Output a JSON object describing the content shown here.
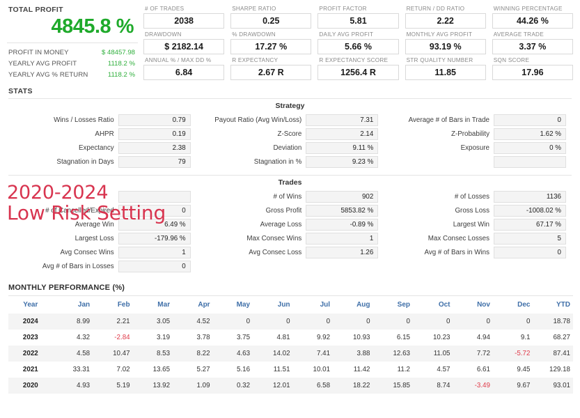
{
  "colors": {
    "green": "#1faa2b",
    "red_overlay": "#d8344f",
    "negative": "#e03b4a",
    "header_blue": "#3f6fa8"
  },
  "summary": {
    "title": "TOTAL PROFIT",
    "big_value": "4845.8 %",
    "rows": [
      {
        "label": "PROFIT IN MONEY",
        "value": "$ 48457.98"
      },
      {
        "label": "YEARLY AVG PROFIT",
        "value": "1118.2 %"
      },
      {
        "label": "YEARLY AVG % RETURN",
        "value": "1118.2 %"
      }
    ]
  },
  "kpis": [
    {
      "label": "# OF TRADES",
      "value": "2038"
    },
    {
      "label": "SHARPE RATIO",
      "value": "0.25"
    },
    {
      "label": "PROFIT FACTOR",
      "value": "5.81"
    },
    {
      "label": "RETURN / DD RATIO",
      "value": "2.22"
    },
    {
      "label": "WINNING PERCENTAGE",
      "value": "44.26 %"
    },
    {
      "label": "DRAWDOWN",
      "value": "$ 2182.14"
    },
    {
      "label": "% DRAWDOWN",
      "value": "17.27 %"
    },
    {
      "label": "DAILY AVG PROFIT",
      "value": "5.66 %"
    },
    {
      "label": "MONTHLY AVG PROFIT",
      "value": "93.19 %"
    },
    {
      "label": "AVERAGE TRADE",
      "value": "3.37 %"
    },
    {
      "label": "ANNUAL % / MAX DD %",
      "value": "6.84"
    },
    {
      "label": "R EXPECTANCY",
      "value": "2.67 R"
    },
    {
      "label": "R EXPECTANCY SCORE",
      "value": "1256.4 R"
    },
    {
      "label": "STR QUALITY NUMBER",
      "value": "11.85"
    },
    {
      "label": "SQN SCORE",
      "value": "17.96"
    }
  ],
  "stats": {
    "title": "STATS",
    "strategy": {
      "heading": "Strategy",
      "cells": [
        {
          "label": "Wins / Losses Ratio",
          "value": "0.79"
        },
        {
          "label": "Payout Ratio (Avg Win/Loss)",
          "value": "7.31"
        },
        {
          "label": "Average # of Bars in Trade",
          "value": "0"
        },
        {
          "label": "AHPR",
          "value": "0.19"
        },
        {
          "label": "Z-Score",
          "value": "2.14"
        },
        {
          "label": "Z-Probability",
          "value": "1.62 %"
        },
        {
          "label": "Expectancy",
          "value": "2.38"
        },
        {
          "label": "Deviation",
          "value": "9.11 %"
        },
        {
          "label": "Exposure",
          "value": "0 %"
        },
        {
          "label": "Stagnation in Days",
          "value": "79"
        },
        {
          "label": "Stagnation in %",
          "value": "9.23 %"
        },
        {
          "label": "",
          "value": ""
        }
      ]
    },
    "trades": {
      "heading": "Trades",
      "cells": [
        {
          "label": "",
          "value": ""
        },
        {
          "label": "# of Wins",
          "value": "902"
        },
        {
          "label": "# of Losses",
          "value": "1136"
        },
        {
          "label": "# of Cancelled/Expired",
          "value": "0"
        },
        {
          "label": "Gross Profit",
          "value": "5853.82 %"
        },
        {
          "label": "Gross Loss",
          "value": "-1008.02 %"
        },
        {
          "label": "Average Win",
          "value": "6.49 %"
        },
        {
          "label": "Average Loss",
          "value": "-0.89 %"
        },
        {
          "label": "Largest Win",
          "value": "67.17 %"
        },
        {
          "label": "Largest Loss",
          "value": "-179.96 %"
        },
        {
          "label": "Max Consec Wins",
          "value": "1"
        },
        {
          "label": "Max Consec Losses",
          "value": "5"
        },
        {
          "label": "Avg Consec Wins",
          "value": "1"
        },
        {
          "label": "Avg Consec Loss",
          "value": "1.26"
        },
        {
          "label": "Avg # of Bars in Wins",
          "value": "0"
        },
        {
          "label": "Avg # of Bars in Losses",
          "value": "0"
        }
      ]
    }
  },
  "overlay": {
    "line1": "2020-2024",
    "line2": "Low Risk Setting"
  },
  "monthly": {
    "title": "MONTHLY PERFORMANCE (%)",
    "columns": [
      "Year",
      "Jan",
      "Feb",
      "Mar",
      "Apr",
      "May",
      "Jun",
      "Jul",
      "Aug",
      "Sep",
      "Oct",
      "Nov",
      "Dec",
      "YTD"
    ],
    "rows": [
      {
        "year": "2024",
        "values": [
          "8.99",
          "2.21",
          "3.05",
          "4.52",
          "0",
          "0",
          "0",
          "0",
          "0",
          "0",
          "0",
          "0",
          "18.78"
        ]
      },
      {
        "year": "2023",
        "values": [
          "4.32",
          "-2.84",
          "3.19",
          "3.78",
          "3.75",
          "4.81",
          "9.92",
          "10.93",
          "6.15",
          "10.23",
          "4.94",
          "9.1",
          "68.27"
        ]
      },
      {
        "year": "2022",
        "values": [
          "4.58",
          "10.47",
          "8.53",
          "8.22",
          "4.63",
          "14.02",
          "7.41",
          "3.88",
          "12.63",
          "11.05",
          "7.72",
          "-5.72",
          "87.41"
        ]
      },
      {
        "year": "2021",
        "values": [
          "33.31",
          "7.02",
          "13.65",
          "5.27",
          "5.16",
          "11.51",
          "10.01",
          "11.42",
          "11.2",
          "4.57",
          "6.61",
          "9.45",
          "129.18"
        ]
      },
      {
        "year": "2020",
        "values": [
          "4.93",
          "5.19",
          "13.92",
          "1.09",
          "0.32",
          "12.01",
          "6.58",
          "18.22",
          "15.85",
          "8.74",
          "-3.49",
          "9.67",
          "93.01"
        ]
      }
    ]
  }
}
